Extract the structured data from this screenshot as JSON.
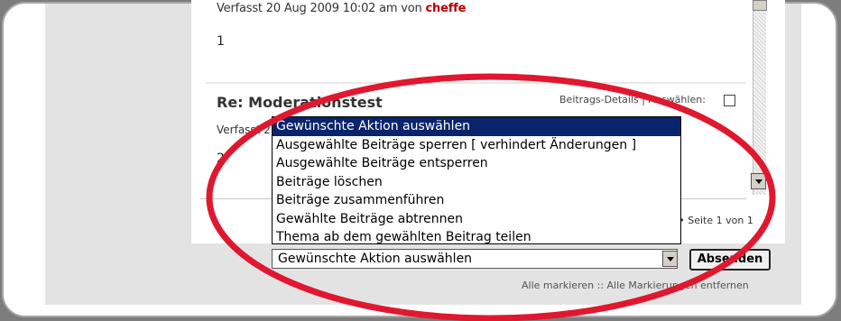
{
  "post1": {
    "meta": "Verfasst 20 Aug 2009 10:02 am von",
    "author": "cheffe",
    "body": "1"
  },
  "post2": {
    "title": "Re: Moderationstest",
    "details": "Beitrags-Details | Auswählen:",
    "meta": "Verfasst 2",
    "body": "2"
  },
  "pagination": "e • Seite 1 von 1",
  "action_select": {
    "selected": "Gewünschte Aktion auswählen",
    "options": [
      "Gewünschte Aktion auswählen",
      "Ausgewählte Beiträge sperren [ verhindert Änderungen ]",
      "Ausgewählte Beiträge entsperren",
      "Beiträge löschen",
      "Beiträge zusammenführen",
      "Gewählte Beiträge abtrennen",
      "Thema ab dem gewählten Beitrag teilen"
    ]
  },
  "submit_label": "Absenden",
  "mark_links": "Alle markieren :: Alle Markierungen entfernen",
  "colors": {
    "highlight_ellipse": "#e0182f",
    "selected_option_bg": "#0a246a",
    "author_name": "#b80000"
  }
}
